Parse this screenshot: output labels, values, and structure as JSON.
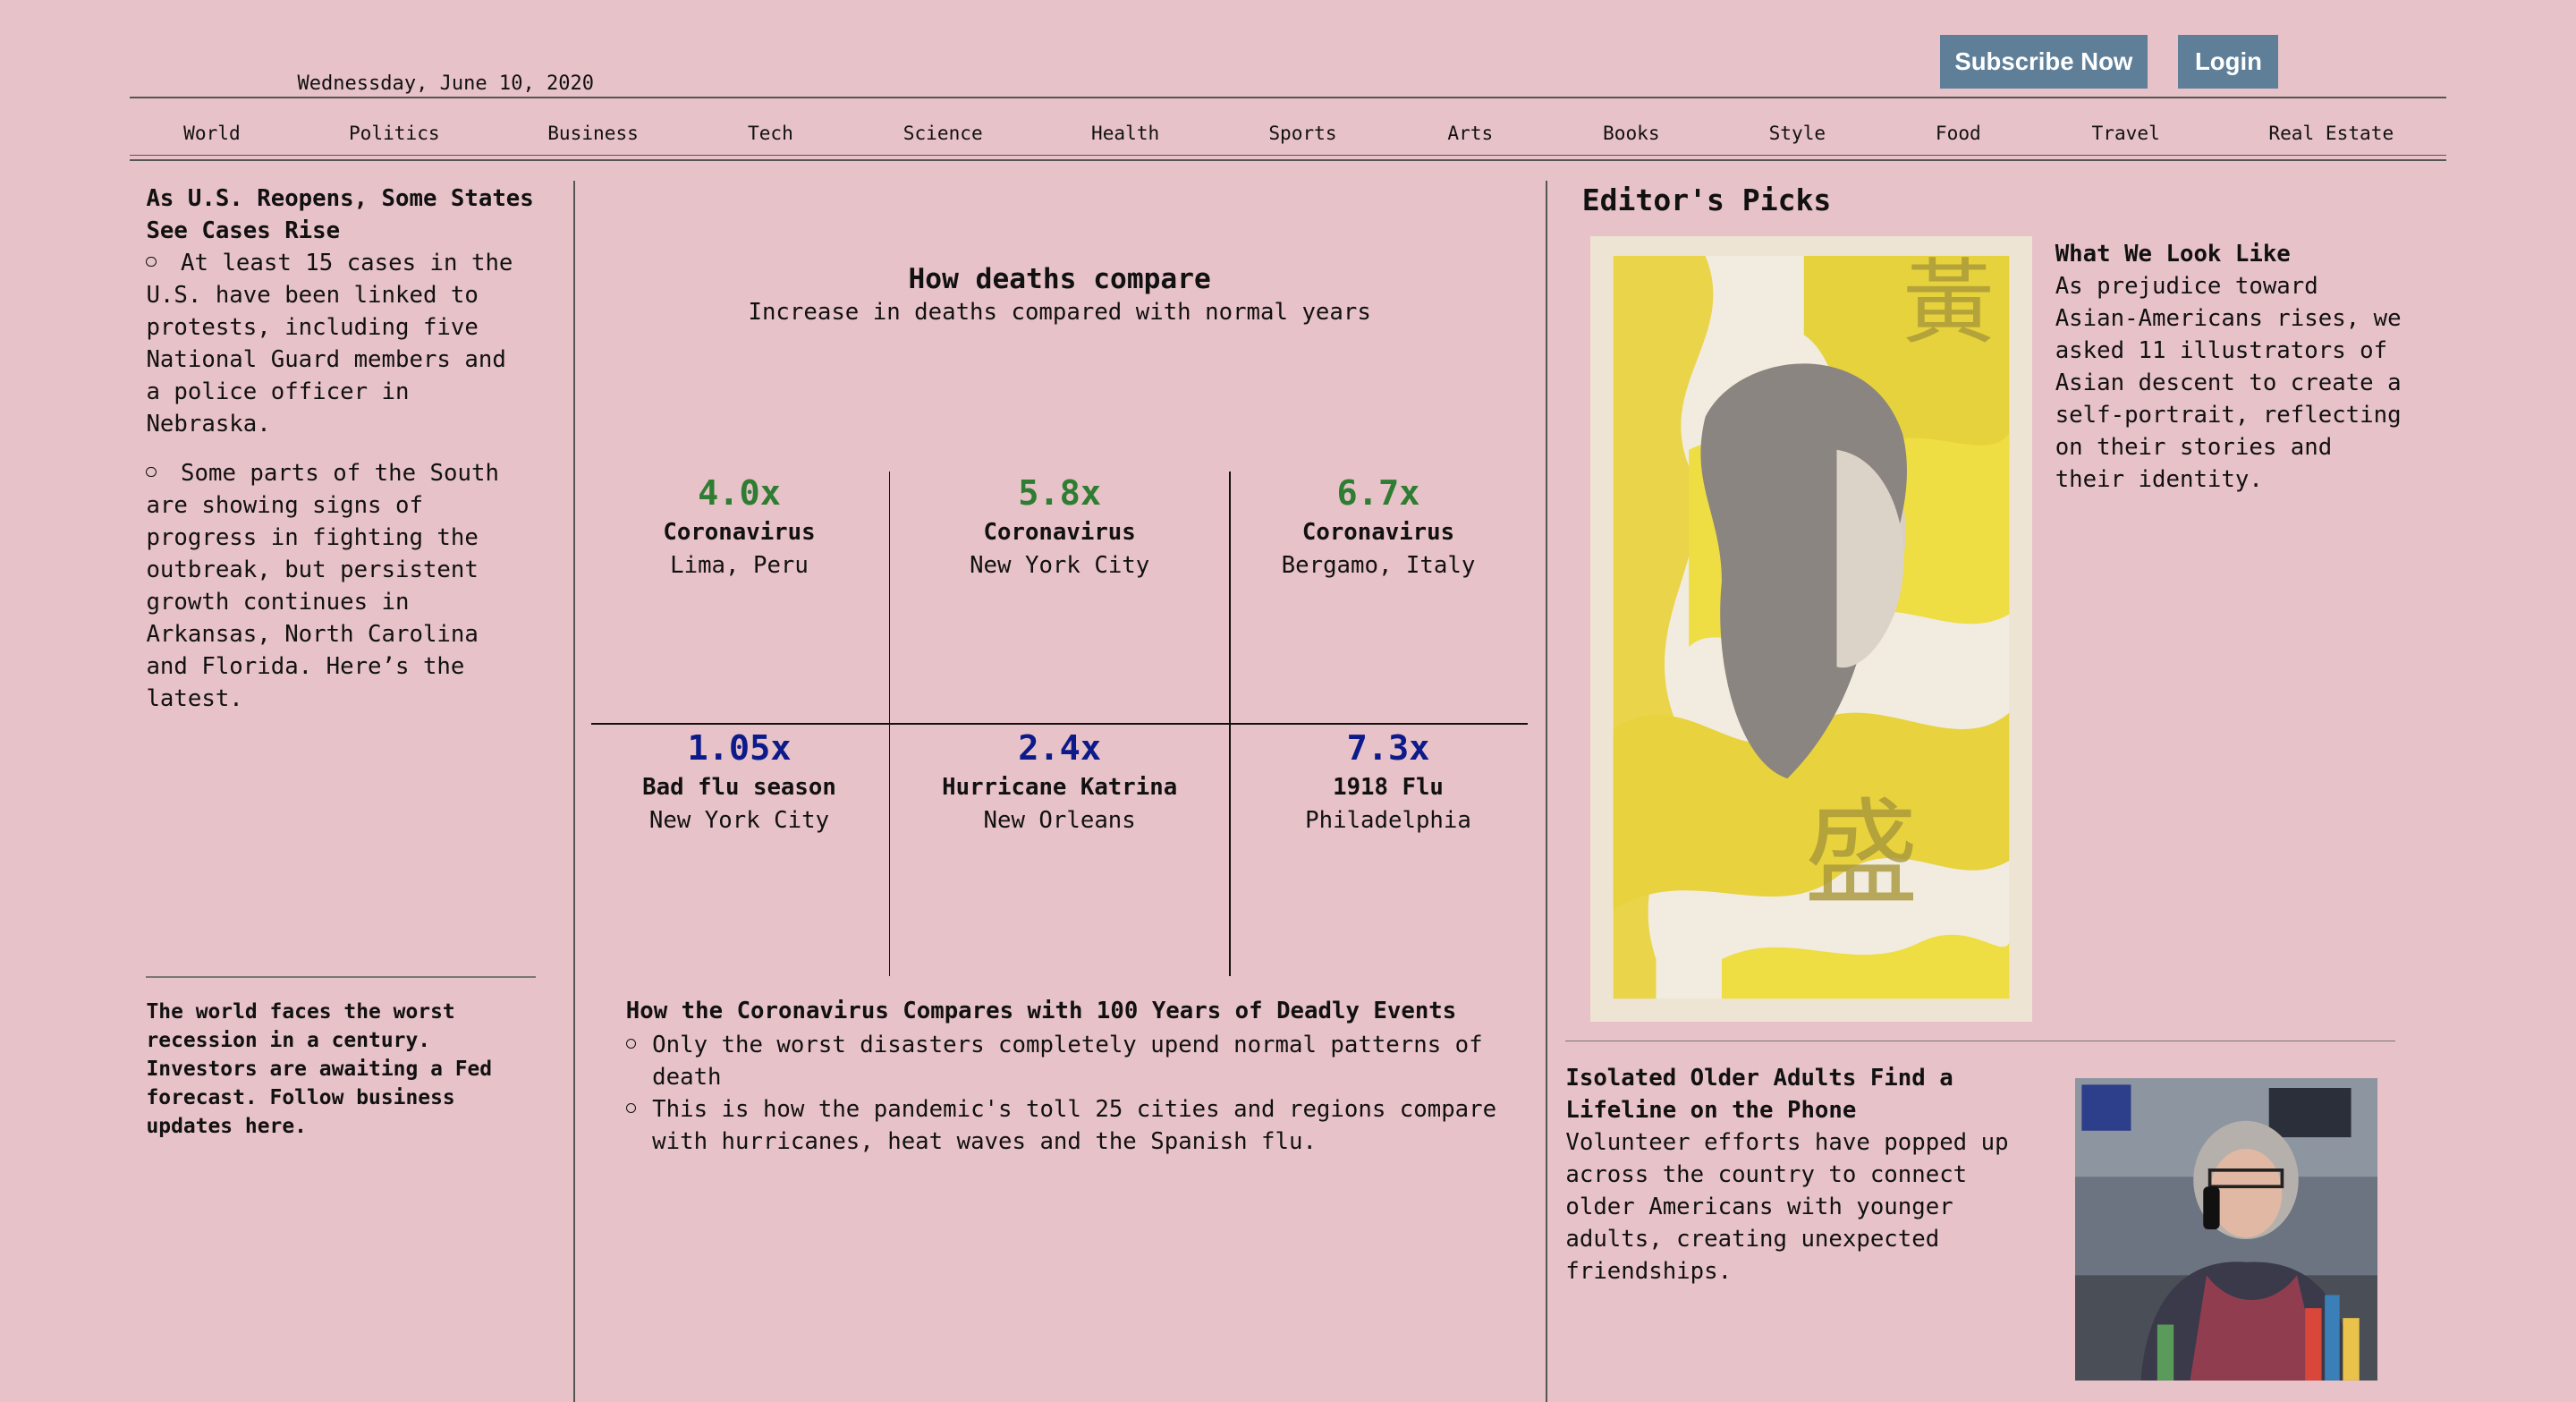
{
  "header": {
    "date": "Wednessday, June 10, 2020",
    "subscribe_label": "Subscribe Now",
    "login_label": "Login",
    "colors": {
      "background": "#e7c2c8",
      "button": "#5f7f99"
    }
  },
  "nav": {
    "items": [
      "World",
      "Politics",
      "Business",
      "Tech",
      "Science",
      "Health",
      "Sports",
      "Arts",
      "Books",
      "Style",
      "Food",
      "Travel",
      "Real Estate"
    ]
  },
  "left": {
    "headline": "As U.S. Reopens, Some States See Cases Rise",
    "bullets": [
      "At least 15 cases in the U.S. have been linked to protests, including five National Guard members and a police officer in Nebraska.",
      "Some parts of the South are showing signs of progress in fighting the outbreak, but persistent growth continues in Arkansas, North Carolina and Florida. Here’s the latest."
    ],
    "footer": "The world faces the worst recession in a century. Investors are awaiting a Fed forecast. Follow business updates here."
  },
  "center": {
    "title": "How deaths compare",
    "subtitle": "Increase in deaths compared with normal years",
    "stats": [
      {
        "value": "4.0x",
        "name": "Coronavirus",
        "location": "Lima, Peru",
        "color": "#2e7d32"
      },
      {
        "value": "5.8x",
        "name": "Coronavirus",
        "location": "New York City",
        "color": "#2e7d32"
      },
      {
        "value": "6.7x",
        "name": "Coronavirus",
        "location": "Bergamo, Italy",
        "color": "#2e7d32"
      },
      {
        "value": "1.05x",
        "name": "Bad flu season",
        "location": "New York City",
        "color": "#0d1a8a"
      },
      {
        "value": "2.4x",
        "name": "Hurricane Katrina",
        "location": "New Orleans",
        "color": "#0d1a8a"
      },
      {
        "value": "7.3x",
        "name": "1918 Flu",
        "location": "Philadelphia",
        "color": "#0d1a8a"
      }
    ],
    "article_title": "How the Coronavirus Compares with 100 Years of Deadly Events",
    "article_bullets": [
      "Only the worst disasters completely upend normal patterns of death",
      "This is how the pandemic's toll 25 cities and regions compare with hurricanes, heat waves and the Spanish flu."
    ]
  },
  "right": {
    "section_title": "Editor's Picks",
    "pick1": {
      "title": "What We Look Like",
      "body": "As prejudice toward Asian-Americans rises, we asked 11 illustrators of Asian descent to create a self-portrait, reflecting on their stories and their identity."
    },
    "pick2": {
      "title": "Isolated Older Adults Find a Lifeline on the Phone",
      "body": "Volunteer efforts have popped up across the country to connect older Americans with younger adults, creating unexpected friendships."
    }
  }
}
